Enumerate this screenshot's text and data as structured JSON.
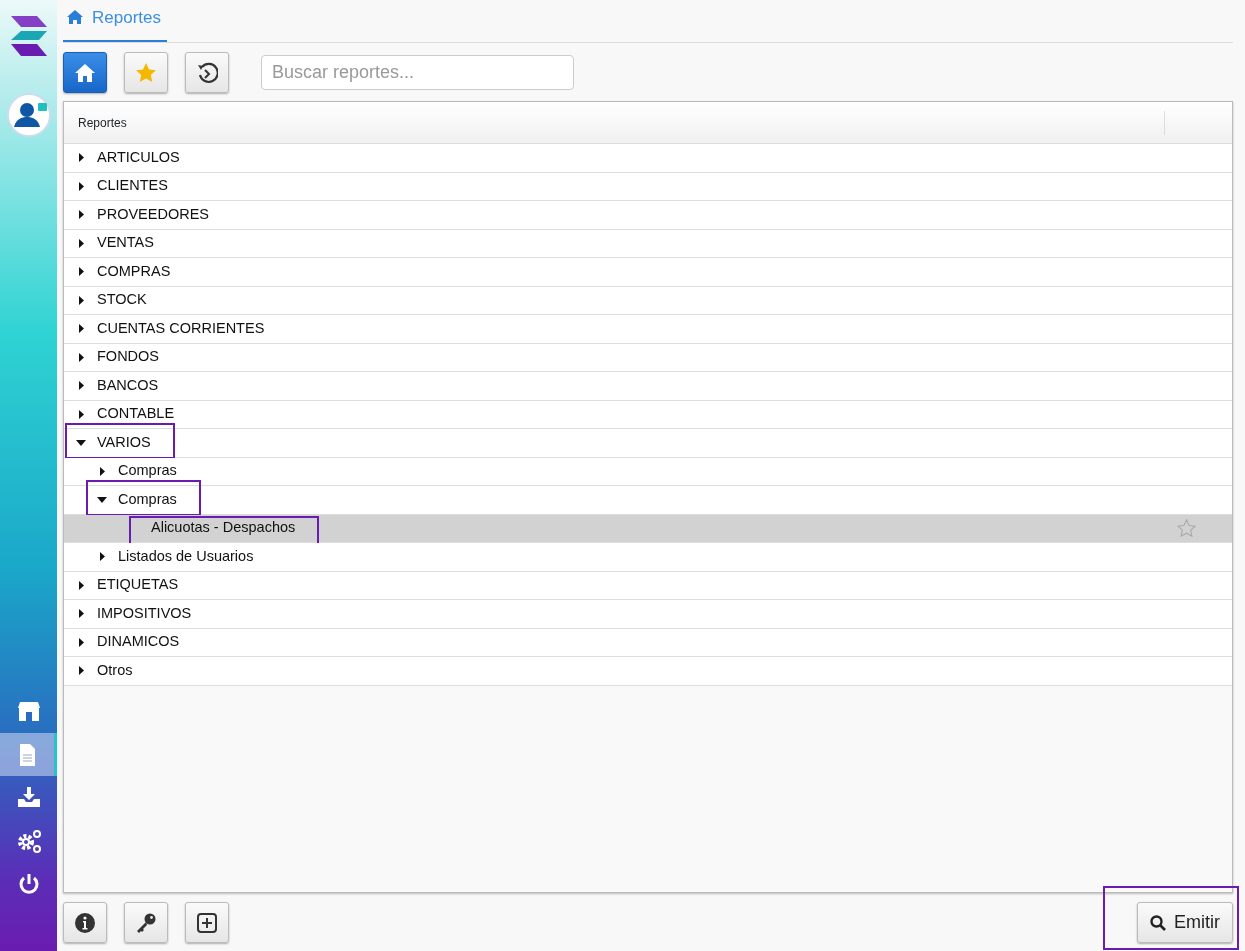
{
  "sidebar": {
    "items": [
      {
        "selected": false
      },
      {
        "selected": true
      },
      {
        "selected": false
      },
      {
        "selected": false
      },
      {
        "selected": false
      }
    ]
  },
  "tabs": [
    {
      "label": "Reportes",
      "selected": true
    }
  ],
  "toolbar": {
    "buttons": [
      {
        "selected": true
      },
      {
        "selected": false
      },
      {
        "selected": false
      }
    ]
  },
  "search": {
    "placeholder": "Buscar reportes..."
  },
  "tree": {
    "header": "Reportes",
    "items": [
      {
        "kind": "folder",
        "label": "ARTICULOS",
        "expanded": false,
        "highlighted": false
      },
      {
        "kind": "folder",
        "label": "CLIENTES",
        "expanded": false,
        "highlighted": false
      },
      {
        "kind": "folder",
        "label": "PROVEEDORES",
        "expanded": false,
        "highlighted": false
      },
      {
        "kind": "folder",
        "label": "VENTAS",
        "expanded": false,
        "highlighted": false
      },
      {
        "kind": "folder",
        "label": "COMPRAS",
        "expanded": false,
        "highlighted": false
      },
      {
        "kind": "folder",
        "label": "STOCK",
        "expanded": false,
        "highlighted": false
      },
      {
        "kind": "folder",
        "label": "CUENTAS CORRIENTES",
        "expanded": false,
        "highlighted": false
      },
      {
        "kind": "folder",
        "label": "FONDOS",
        "expanded": false,
        "highlighted": false
      },
      {
        "kind": "folder",
        "label": "BANCOS",
        "expanded": false,
        "highlighted": false
      },
      {
        "kind": "folder",
        "label": "CONTABLE",
        "expanded": false,
        "highlighted": false
      },
      {
        "kind": "folder",
        "label": "VARIOS",
        "expanded": true,
        "highlighted": true,
        "children": [
          {
            "kind": "folder",
            "label": "Compras",
            "expanded": false,
            "highlighted": false
          },
          {
            "kind": "folder",
            "label": "Compras",
            "expanded": true,
            "highlighted": true,
            "children": [
              {
                "kind": "report",
                "label": "Alicuotas - Despachos",
                "selected": true,
                "highlighted": true,
                "favorite": false
              }
            ]
          },
          {
            "kind": "folder",
            "label": "Listados de Usuarios",
            "expanded": false,
            "highlighted": false
          }
        ]
      },
      {
        "kind": "folder",
        "label": "ETIQUETAS",
        "expanded": false,
        "highlighted": false
      },
      {
        "kind": "folder",
        "label": "IMPOSITIVOS",
        "expanded": false,
        "highlighted": false
      },
      {
        "kind": "folder",
        "label": "DINAMICOS",
        "expanded": false,
        "highlighted": false
      },
      {
        "kind": "folder",
        "label": "Otros",
        "expanded": false,
        "highlighted": false
      }
    ]
  },
  "footer": {
    "emit_button": {
      "label": "Emitir",
      "highlighted": true
    }
  }
}
